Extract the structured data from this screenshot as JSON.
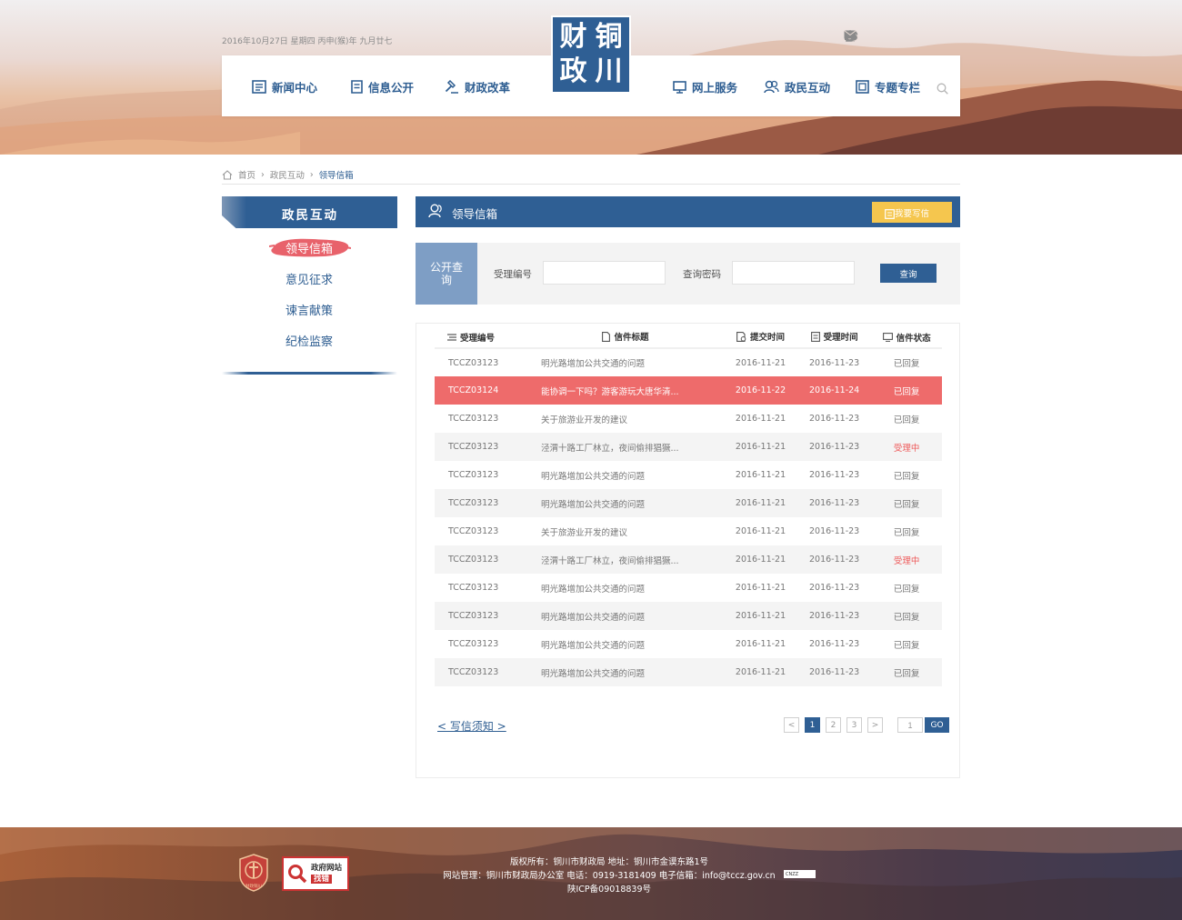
{
  "header": {
    "date": "2016年10月27日 星期四 丙申(猴)年 九月廿七",
    "logo_chars": [
      "财",
      "铜",
      "政",
      "川"
    ],
    "nav_left": [
      {
        "label": "新闻中心",
        "icon": "news-icon"
      },
      {
        "label": "信息公开",
        "icon": "document-icon"
      },
      {
        "label": "财政改革",
        "icon": "hammer-icon"
      }
    ],
    "nav_right": [
      {
        "label": "网上服务",
        "icon": "monitor-icon"
      },
      {
        "label": "政民互动",
        "icon": "users-icon"
      },
      {
        "label": "专题专栏",
        "icon": "column-icon"
      }
    ],
    "top_icons": [
      "home-icon",
      "book-icon",
      "wechat-icon",
      "weibo-icon",
      "mail-icon"
    ]
  },
  "breadcrumb": {
    "home": "首页",
    "section": "政民互动",
    "current": "领导信箱"
  },
  "sidebar": {
    "title": "政民互动",
    "items": [
      {
        "label": "领导信箱",
        "active": true
      },
      {
        "label": "意见征求",
        "active": false
      },
      {
        "label": "谏言献策",
        "active": false
      },
      {
        "label": "纪检监察",
        "active": false
      }
    ]
  },
  "panel": {
    "title": "领导信箱",
    "write_button": "我要写信"
  },
  "query": {
    "tag": "公开查询",
    "id_label": "受理编号",
    "id_value": "",
    "pwd_label": "查询密码",
    "pwd_value": "",
    "button": "查询"
  },
  "table": {
    "headers": [
      "受理编号",
      "信件标题",
      "提交时间",
      "受理时间",
      "信件状态"
    ],
    "rows": [
      {
        "id": "TCCZ03123",
        "title": "明光路增加公共交通的问题",
        "submit": "2016-11-21",
        "accept": "2016-11-23",
        "status": "已回复"
      },
      {
        "id": "TCCZ03124",
        "title": "能协调一下吗？游客游玩大唐华清...",
        "submit": "2016-11-22",
        "accept": "2016-11-24",
        "status": "已回复"
      },
      {
        "id": "TCCZ03123",
        "title": "关于旅游业开发的建议",
        "submit": "2016-11-21",
        "accept": "2016-11-23",
        "status": "已回复"
      },
      {
        "id": "TCCZ03123",
        "title": "泾渭十路工厂林立，夜间偷排猖獗...",
        "submit": "2016-11-21",
        "accept": "2016-11-23",
        "status": "受理中"
      },
      {
        "id": "TCCZ03123",
        "title": "明光路增加公共交通的问题",
        "submit": "2016-11-21",
        "accept": "2016-11-23",
        "status": "已回复"
      },
      {
        "id": "TCCZ03123",
        "title": "明光路增加公共交通的问题",
        "submit": "2016-11-21",
        "accept": "2016-11-23",
        "status": "已回复"
      },
      {
        "id": "TCCZ03123",
        "title": "关于旅游业开发的建议",
        "submit": "2016-11-21",
        "accept": "2016-11-23",
        "status": "已回复"
      },
      {
        "id": "TCCZ03123",
        "title": "泾渭十路工厂林立，夜间偷排猖獗...",
        "submit": "2016-11-21",
        "accept": "2016-11-23",
        "status": "受理中"
      },
      {
        "id": "TCCZ03123",
        "title": "明光路增加公共交通的问题",
        "submit": "2016-11-21",
        "accept": "2016-11-23",
        "status": "已回复"
      },
      {
        "id": "TCCZ03123",
        "title": "明光路增加公共交通的问题",
        "submit": "2016-11-21",
        "accept": "2016-11-23",
        "status": "已回复"
      },
      {
        "id": "TCCZ03123",
        "title": "明光路增加公共交通的问题",
        "submit": "2016-11-21",
        "accept": "2016-11-23",
        "status": "已回复"
      },
      {
        "id": "TCCZ03123",
        "title": "明光路增加公共交通的问题",
        "submit": "2016-11-21",
        "accept": "2016-11-23",
        "status": "已回复"
      }
    ]
  },
  "notice_link": "< 写信须知 >",
  "pager": {
    "prev": "<",
    "pages": [
      "1",
      "2",
      "3"
    ],
    "current": "1",
    "next": ">",
    "jump_value": "1",
    "go": "GO"
  },
  "footer": {
    "line1": "版权所有：铜川市财政局      地址：铜川市金谟东路1号",
    "line2": "网站管理：铜川市财政局办公室    电话：0919-3181409    电子信箱：info@tccz.gov.cn",
    "line3": "陕ICP备09018839号",
    "emblem_text": "财政铜川",
    "gov_line1": "政府网站",
    "gov_line2": "找错",
    "cnzz": "CNZZ"
  },
  "colors": {
    "primary": "#2f5f94",
    "highlight_row": "#ee6b6b",
    "write_button": "#f5c64e",
    "query_tag": "#7e9ec5",
    "pending": "#ee5a5a"
  }
}
